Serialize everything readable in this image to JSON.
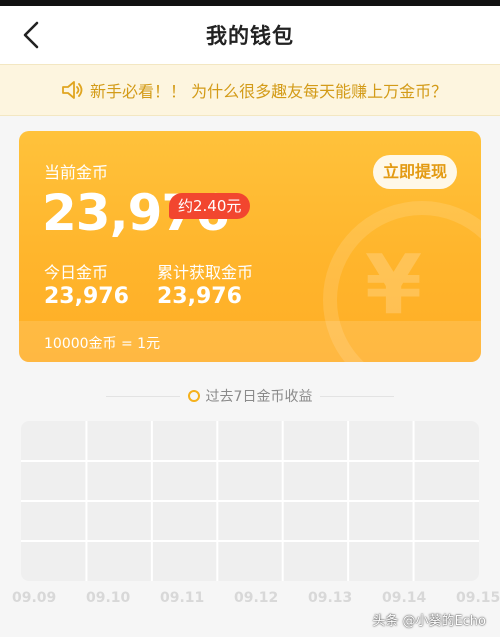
{
  "header": {
    "title": "我的钱包"
  },
  "notice": {
    "text": "新手必看！！ 为什么很多趣友每天能赚上万金币？"
  },
  "wallet": {
    "current_label": "当前金币",
    "current_value": "23,976",
    "approx_label": "约2.40元",
    "withdraw_label": "立即提现",
    "today_label": "今日金币",
    "today_value": "23,976",
    "total_label": "累计获取金币",
    "total_value": "23,976",
    "rate_text": "10000金币 = 1元"
  },
  "chart_caption": "过去7日金币收益",
  "chart_data": {
    "type": "line",
    "title": "过去7日金币收益",
    "categories": [
      "09.09",
      "09.10",
      "09.11",
      "09.12",
      "09.13",
      "09.14",
      "09.15"
    ],
    "series": [],
    "grid": true
  },
  "watermark": "头条 @小葵的Echo",
  "colors": {
    "accent": "#ffb52c",
    "badge": "#f2462f",
    "notice_text": "#d39b18"
  },
  "icons": {
    "back": "chevron-left-icon",
    "notice": "speaker-icon",
    "caption_dot": "circle-icon"
  }
}
